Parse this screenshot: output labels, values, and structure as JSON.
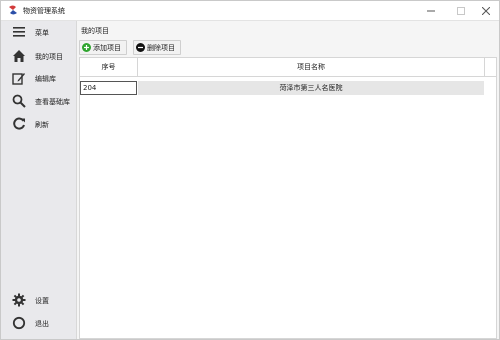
{
  "window": {
    "title": "物资管理系统"
  },
  "sidebar": {
    "items": [
      {
        "label": "菜单",
        "icon": "menu-icon"
      },
      {
        "label": "我的项目",
        "icon": "home-icon"
      },
      {
        "label": "编辑库",
        "icon": "edit-icon"
      },
      {
        "label": "查看基础库",
        "icon": "search-icon"
      },
      {
        "label": "刷新",
        "icon": "refresh-icon"
      },
      {
        "label": "设置",
        "icon": "gear-icon"
      },
      {
        "label": "退出",
        "icon": "circle-icon"
      }
    ]
  },
  "main": {
    "breadcrumb": "我的项目",
    "toolbar": {
      "add_label": "添加项目",
      "delete_label": "删除项目"
    },
    "table": {
      "columns": [
        "序号",
        "项目名称"
      ],
      "rows": [
        {
          "seq": "204",
          "name": "菏泽市第三人名医院"
        }
      ]
    }
  },
  "colors": {
    "accent_add": "#2fa52f",
    "sidebar_bg": "#e9e9ec",
    "app_icon_red": "#d23a3a",
    "app_icon_blue": "#2b4fa8"
  }
}
